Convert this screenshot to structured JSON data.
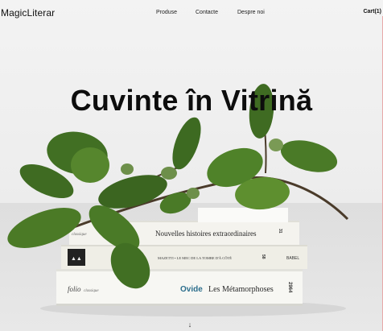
{
  "brand": "MagicLiterar",
  "nav": {
    "links": [
      "Produse",
      "Contacte",
      "Despre noi"
    ],
    "cart": "Cart(1)"
  },
  "hero": {
    "title": "Cuvinte în Vitrină",
    "scroll_icon": "arrow-down-icon",
    "books": [
      {
        "title": "Nouvelles histoires extraordinaires",
        "mark": "31",
        "edition": "classique"
      },
      {
        "title": "MAZETTI • LE MEC DE LA TOMBE D'À CÔTÉ",
        "mark": "58",
        "publisher": "BABEL"
      },
      {
        "publisher": "folio",
        "edition": "classique",
        "author": "Ovide",
        "title": "Les Métamorphoses",
        "mark": "2964"
      }
    ]
  },
  "colors": {
    "background": "#efefef",
    "text": "#0d0d0d",
    "leaf": "#3f6b22"
  }
}
